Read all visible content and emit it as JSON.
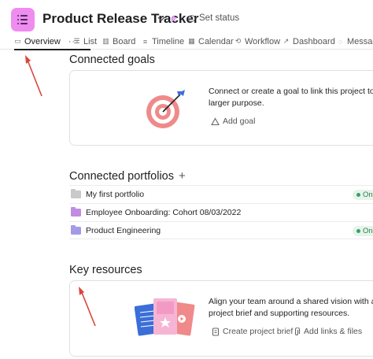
{
  "header": {
    "title": "Product Release Tracker",
    "status_label": "Set status",
    "accent_color": "#ef8cf0"
  },
  "tabs": [
    {
      "label": "Overview",
      "icon": "clipboard-icon",
      "active": true
    },
    {
      "label": "List",
      "icon": "list-icon"
    },
    {
      "label": "Board",
      "icon": "board-icon"
    },
    {
      "label": "Timeline",
      "icon": "timeline-icon"
    },
    {
      "label": "Calendar",
      "icon": "calendar-icon"
    },
    {
      "label": "Workflow",
      "icon": "workflow-icon"
    },
    {
      "label": "Dashboard",
      "icon": "dashboard-icon"
    },
    {
      "label": "Messages",
      "icon": "message-icon"
    }
  ],
  "goals": {
    "title": "Connected goals",
    "description": "Connect or create a goal to link this project to a larger purpose.",
    "add_label": "Add goal"
  },
  "portfolios": {
    "title": "Connected portfolios",
    "items": [
      {
        "name": "My first portfolio",
        "status": "On",
        "color": "#c9c9c9"
      },
      {
        "name": "Employee Onboarding: Cohort 08/03/2022",
        "status": "",
        "color": "#c08be0"
      },
      {
        "name": "Product Engineering",
        "status": "On",
        "color": "#a49be6"
      }
    ]
  },
  "resources": {
    "title": "Key resources",
    "description": "Align your team around a shared vision with a project brief and supporting resources.",
    "create_brief_label": "Create project brief",
    "add_links_label": "Add links & files"
  }
}
